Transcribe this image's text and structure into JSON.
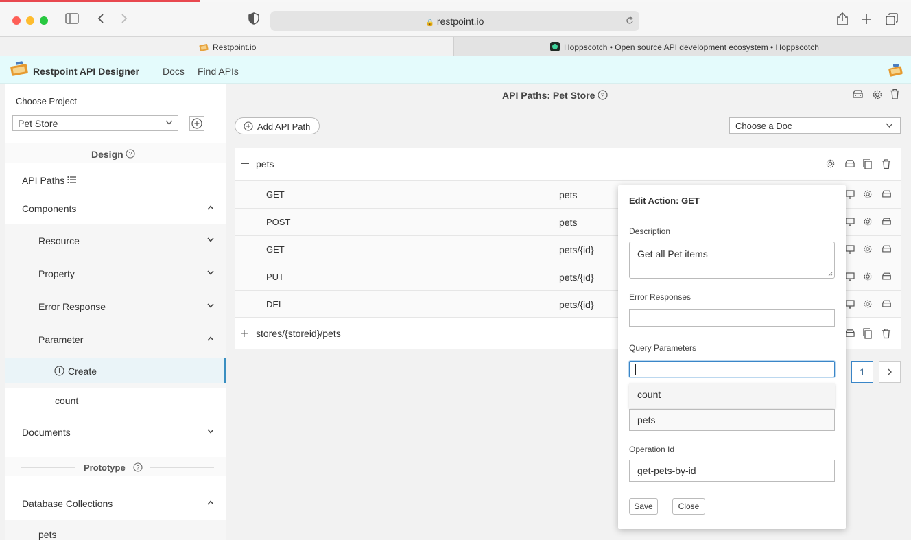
{
  "browser": {
    "url": "restpoint.io",
    "tabs": [
      {
        "label": "Restpoint.io",
        "active": true
      },
      {
        "label": "Hoppscotch • Open source API development ecosystem • Hoppscotch",
        "active": false
      }
    ]
  },
  "header": {
    "brand": "Restpoint API Designer",
    "nav": [
      "Docs",
      "Find APIs"
    ]
  },
  "sidebar": {
    "project_label": "Choose Project",
    "project_value": "Pet Store",
    "design_heading": "Design",
    "api_paths": "API Paths",
    "components": "Components",
    "resource": "Resource",
    "property": "Property",
    "error_response": "Error Response",
    "parameter": "Parameter",
    "create": "Create",
    "count": "count",
    "documents": "Documents",
    "prototype_heading": "Prototype",
    "database_collections": "Database Collections",
    "pets": "pets"
  },
  "main": {
    "title": "API Paths: Pet Store",
    "add_path": "Add API Path",
    "doc_select_placeholder": "Choose a Doc",
    "group1": "pets",
    "group2": "stores/{storeid}/pets",
    "rows": [
      {
        "method": "GET",
        "path": "pets"
      },
      {
        "method": "POST",
        "path": "pets"
      },
      {
        "method": "GET",
        "path": "pets/{id}"
      },
      {
        "method": "PUT",
        "path": "pets/{id}"
      },
      {
        "method": "DEL",
        "path": "pets/{id}"
      }
    ],
    "page_number": "1"
  },
  "popup": {
    "title": "Edit Action: GET",
    "description_label": "Description",
    "description_value": "Get all Pet items",
    "error_responses_label": "Error Responses",
    "error_responses_value": "",
    "query_parameters_label": "Query Parameters",
    "query_parameters_value": "",
    "suggestion": "count",
    "resource_value": "pets",
    "operation_id_label": "Operation Id",
    "operation_id_value": "get-pets-by-id",
    "save": "Save",
    "close": "Close"
  },
  "colors": {
    "header_bg": "#e4fbfc",
    "active_accent": "#3a8fc1",
    "focus_border": "#3a86c8"
  }
}
